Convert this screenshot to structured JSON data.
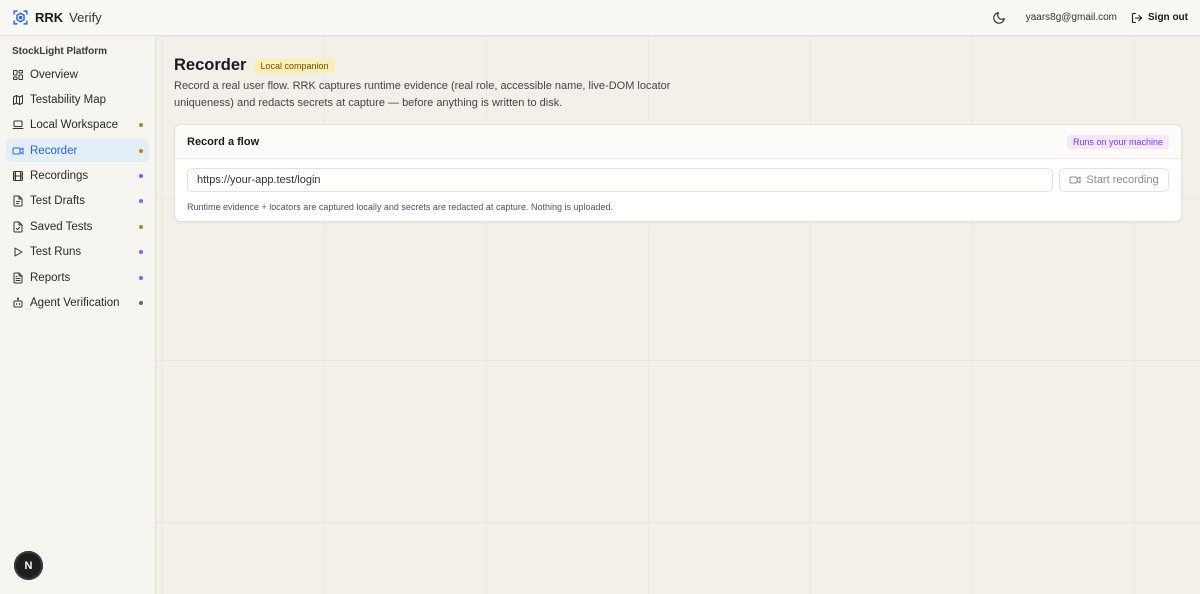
{
  "header": {
    "brand_bold": "RRK",
    "brand_rest": "Verify",
    "user_email": "yaars8g@gmail.com",
    "sign_out_label": "Sign out",
    "icons": {
      "logo": "scan-target-icon",
      "theme": "moon-icon",
      "sign_out": "log-out-icon"
    }
  },
  "sidebar": {
    "group_label": "StockLight Platform",
    "active": "Recorder",
    "items": [
      {
        "label": "Overview",
        "icon": "dashboard-grid-icon",
        "dot": null
      },
      {
        "label": "Testability Map",
        "icon": "map-icon",
        "dot": null
      },
      {
        "label": "Local Workspace",
        "icon": "laptop-icon",
        "dot": "#b8860b"
      },
      {
        "label": "Recorder",
        "icon": "video-camera-icon",
        "dot": "#b8860b"
      },
      {
        "label": "Recordings",
        "icon": "film-icon",
        "dot": "#8b5cf6"
      },
      {
        "label": "Test Drafts",
        "icon": "file-draft-icon",
        "dot": "#8b5cf6"
      },
      {
        "label": "Saved Tests",
        "icon": "file-check-icon",
        "dot": "#b8860b"
      },
      {
        "label": "Test Runs",
        "icon": "play-icon",
        "dot": "#8b5cf6"
      },
      {
        "label": "Reports",
        "icon": "file-text-icon",
        "dot": "#8b5cf6"
      },
      {
        "label": "Agent Verification",
        "icon": "bot-icon",
        "dot": "#666666"
      }
    ],
    "avatar_letter": "N"
  },
  "main": {
    "title": "Recorder",
    "badge": "Local companion",
    "description": "Record a real user flow. RRK captures runtime evidence (real role, accessible name, live-DOM locator uniqueness) and redacts secrets at capture — before anything is written to disk.",
    "card": {
      "title": "Record a flow",
      "badge": "Runs on your machine",
      "url_value": "https://your-app.test/login",
      "start_button": "Start recording",
      "note": "Runtime evidence + locators are captured locally and secrets are redacted at capture. Nothing is uploaded."
    }
  },
  "colors": {
    "accent": "#2563eb",
    "local_badge_bg": "#fbeeb4",
    "machine_badge_bg": "#f3e8fd",
    "machine_badge_text": "#7c3aed"
  }
}
